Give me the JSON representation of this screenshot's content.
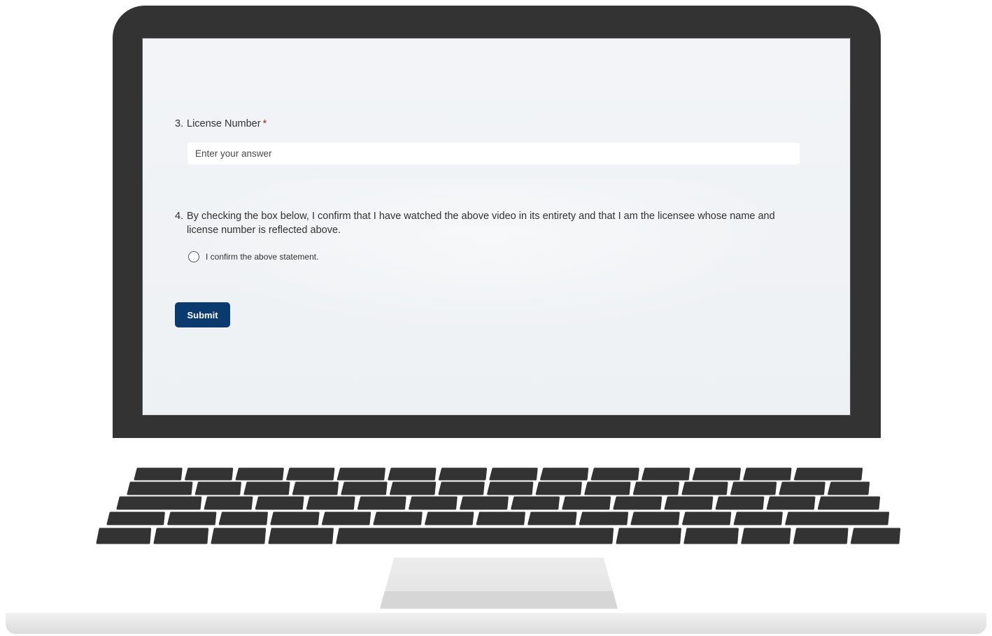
{
  "form": {
    "q3": {
      "number": "3.",
      "label": "License Number",
      "required_mark": "*",
      "placeholder": "Enter your answer",
      "value": ""
    },
    "q4": {
      "number": "4.",
      "label": "By checking the box below, I confirm that I have watched the above video in its entirety and that I am the licensee whose name and license number is reflected above.",
      "option_label": "I confirm the above statement.",
      "selected": false
    },
    "submit_label": "Submit"
  },
  "colors": {
    "bezel": "#333333",
    "screen_bg": "#f2f4f7",
    "submit_bg": "#0b3a6f",
    "required": "#a4262c"
  }
}
